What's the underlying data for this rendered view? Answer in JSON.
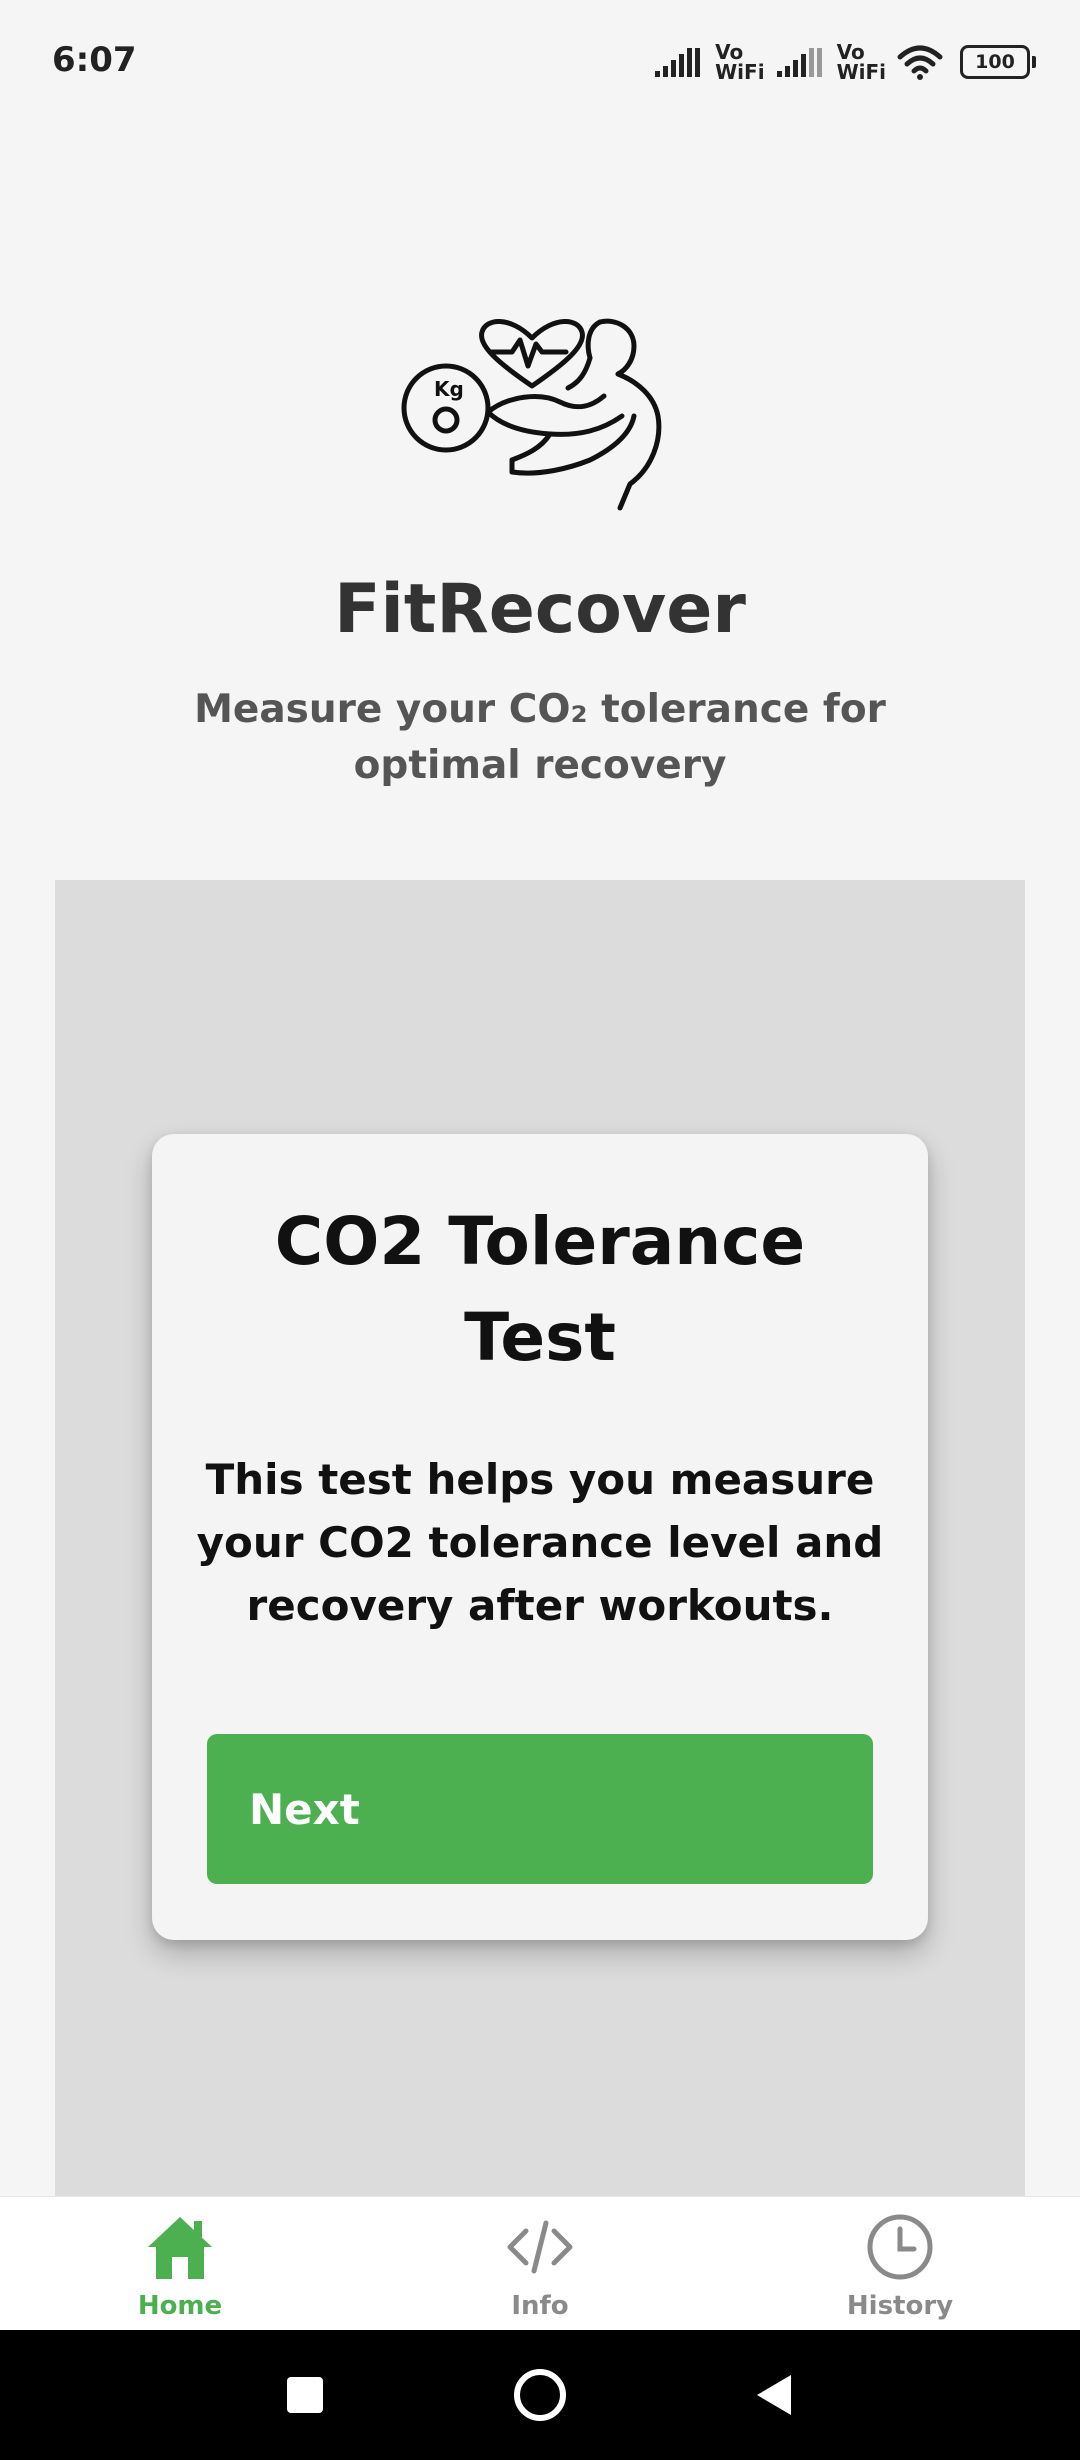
{
  "status_bar": {
    "time": "6:07",
    "volte_1": "Vo\nWiFi",
    "volte_2": "Vo\nWiFi",
    "battery": "100"
  },
  "header": {
    "title": "FitRecover",
    "subtitle": "Measure your CO₂ tolerance for optimal recovery",
    "logo_text": "Kg"
  },
  "card": {
    "title": "CO2 Tolerance Test",
    "description": "This test helps you measure your CO2 tolerance level and recovery after workouts.",
    "next_label": "Next"
  },
  "bottom_nav": {
    "items": [
      {
        "label": "Home",
        "icon": "home-icon",
        "active": true
      },
      {
        "label": "Info",
        "icon": "code-icon",
        "active": false
      },
      {
        "label": "History",
        "icon": "clock-icon",
        "active": false
      }
    ]
  },
  "colors": {
    "accent": "#4caf50",
    "background": "#f5f5f5",
    "panel": "#dcdcdc",
    "nav_inactive": "#8a8a8a"
  }
}
